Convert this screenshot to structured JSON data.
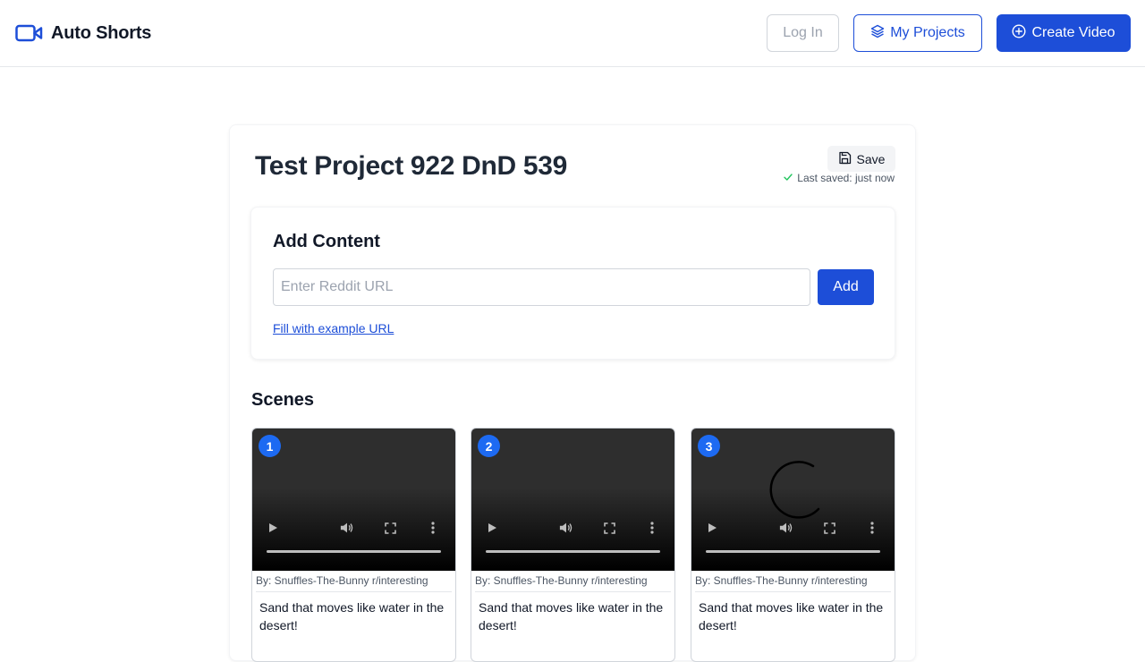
{
  "app": {
    "name": "Auto Shorts",
    "brand_color": "#1d4ed8"
  },
  "header": {
    "login_label": "Log In",
    "projects_label": "My Projects",
    "create_label": "Create Video"
  },
  "project": {
    "title": "Test Project 922 DnD 539",
    "save_label": "Save",
    "last_saved": "Last saved: just now"
  },
  "add_content": {
    "heading": "Add Content",
    "url_placeholder": "Enter Reddit URL",
    "url_value": "",
    "add_label": "Add",
    "example_link": "Fill with example URL"
  },
  "scenes": {
    "heading": "Scenes",
    "items": [
      {
        "number": "1",
        "byline": "By: Snuffles-The-Bunny r/interesting",
        "caption": "Sand that moves like water in the desert!",
        "loading": false
      },
      {
        "number": "2",
        "byline": "By: Snuffles-The-Bunny r/interesting",
        "caption": "Sand that moves like water in the desert!",
        "loading": false
      },
      {
        "number": "3",
        "byline": "By: Snuffles-The-Bunny r/interesting",
        "caption": "Sand that moves like water in the desert!",
        "loading": true
      }
    ]
  },
  "icons": {
    "brand": "video-camera-icon",
    "projects": "layers-icon",
    "create": "plus-circle-icon",
    "save": "floppy-disk-icon",
    "saved": "check-icon"
  }
}
